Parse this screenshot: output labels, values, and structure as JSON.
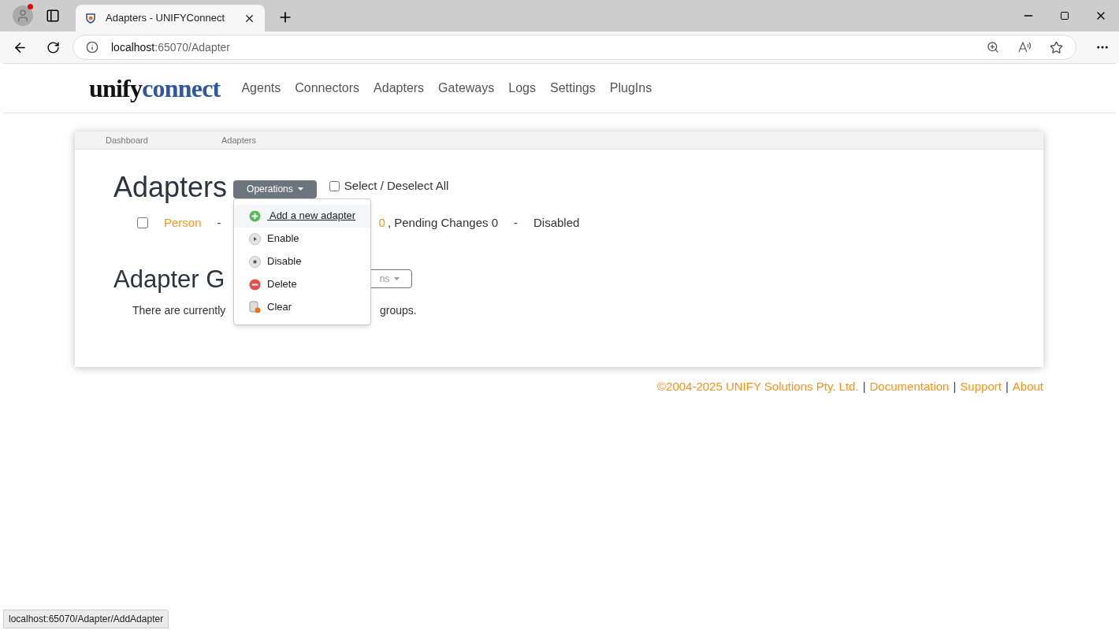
{
  "browser": {
    "tab_title": "Adapters - UNIFYConnect",
    "url_host": "localhost",
    "url_path": ":65070/Adapter",
    "status_url": "localhost:65070/Adapter/AddAdapter"
  },
  "logo": {
    "part_1": "unify",
    "part_2": "connect"
  },
  "nav": [
    {
      "label": "Agents"
    },
    {
      "label": "Connectors"
    },
    {
      "label": "Adapters"
    },
    {
      "label": "Gateways"
    },
    {
      "label": "Logs"
    },
    {
      "label": "Settings"
    },
    {
      "label": "PlugIns"
    }
  ],
  "breadcrumb": [
    {
      "label": "Dashboard"
    },
    {
      "label": "Adapters"
    }
  ],
  "adapters": {
    "title": "Adapters",
    "operations": "Operations",
    "select_all": {
      "label": "Select / Deselect All",
      "checked": false
    },
    "rows": [
      {
        "name": "Person",
        "checked": false,
        "sep_1": "-",
        "count_tail": "0",
        "pending": ", Pending Changes 0",
        "sep_2": "-",
        "status": "Disabled"
      }
    ]
  },
  "menu": [
    {
      "label": " Add a new adapter",
      "kind": "add",
      "selected": true
    },
    {
      "label": "Enable",
      "kind": "enable",
      "selected": false
    },
    {
      "label": "Disable",
      "kind": "disable",
      "selected": false
    },
    {
      "label": "Delete",
      "kind": "delete",
      "selected": false
    },
    {
      "label": "Clear",
      "kind": "clear",
      "selected": false
    }
  ],
  "groups": {
    "title": "Adapter G",
    "button_tail": "ns",
    "text_start": "There are currently",
    "text_end": "groups."
  },
  "footer": [
    {
      "label": "©2004-2025 UNIFY Solutions Pty. Ltd."
    },
    {
      "separator": "|",
      "label": "Documentation"
    },
    {
      "separator": "|",
      "label": "Support"
    },
    {
      "separator": "|",
      "label": "About"
    }
  ]
}
